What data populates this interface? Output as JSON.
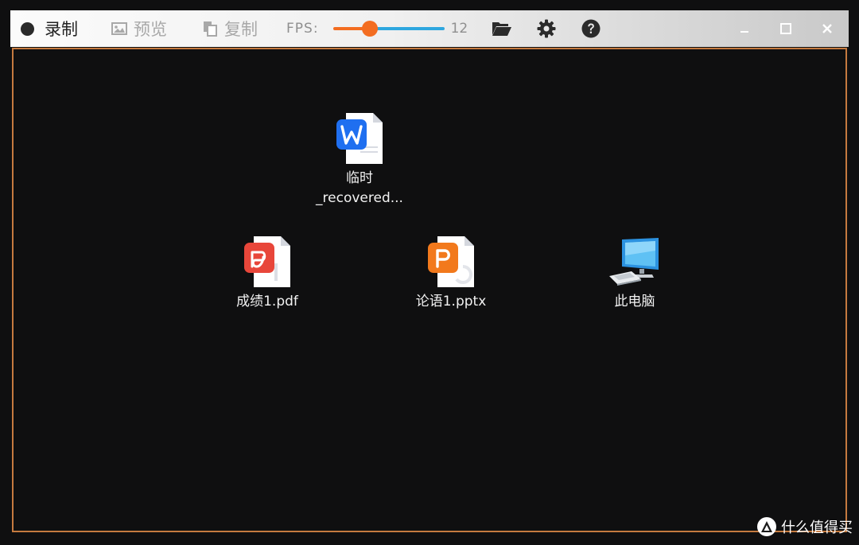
{
  "toolbar": {
    "record_label": "录制",
    "preview_label": "预览",
    "copy_label": "复制",
    "fps_label": "FPS:",
    "fps_value": "12",
    "fps_fraction": 0.33
  },
  "desktop": {
    "icons": [
      {
        "label_line1": "临时",
        "label_line2": "_recovered...",
        "kind": "wps-writer-doc-icon"
      },
      {
        "label": "成绩1.pdf",
        "kind": "pdf-icon"
      },
      {
        "label": "论语1.pptx",
        "kind": "pptx-icon"
      },
      {
        "label": "此电脑",
        "kind": "computer-icon"
      }
    ]
  },
  "watermark": {
    "text": "什么值得买"
  },
  "colors": {
    "accent_orange": "#f36d21",
    "slider_blue": "#2ea7df",
    "border_orange": "#c57a3f"
  }
}
